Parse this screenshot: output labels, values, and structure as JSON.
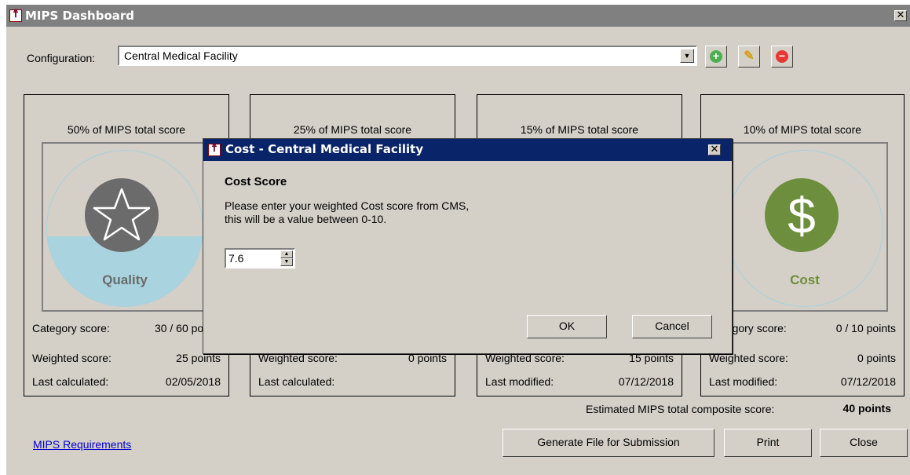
{
  "window": {
    "title": "MIPS Dashboard",
    "close_glyph": "✕"
  },
  "config": {
    "label": "Configuration:",
    "value": "Central Medical Facility"
  },
  "toolbar": {
    "add_icon": "plus-circle-icon",
    "edit_icon": "pencil-icon",
    "remove_icon": "minus-circle-icon"
  },
  "cards": [
    {
      "percent": "50% of MIPS total score",
      "graphic_label": "Quality",
      "fill_level": 0.45,
      "rows": [
        {
          "k": "Category score:",
          "v": "30 / 60 points"
        },
        {
          "k": "Weighted score:",
          "v": "25 points"
        },
        {
          "k": "Last calculated:",
          "v": "02/05/2018"
        }
      ]
    },
    {
      "percent": "25% of MIPS total score",
      "rows": [
        {
          "k": "",
          "v": ""
        },
        {
          "k": "Weighted score:",
          "v": "0 points"
        },
        {
          "k": "Last calculated:",
          "v": ""
        }
      ]
    },
    {
      "percent": "15% of MIPS total score",
      "rows": [
        {
          "k": "",
          "v": ""
        },
        {
          "k": "Weighted score:",
          "v": "15 points"
        },
        {
          "k": "Last modified:",
          "v": "07/12/2018"
        }
      ]
    },
    {
      "percent": "10% of MIPS total score",
      "graphic_label": "Cost",
      "rows": [
        {
          "k": "Category score:",
          "v": "0 / 10 points"
        },
        {
          "k": "Weighted score:",
          "v": "0 points"
        },
        {
          "k": "Last modified:",
          "v": "07/12/2018"
        }
      ]
    }
  ],
  "estimate": {
    "label": "Estimated MIPS total composite score:",
    "value": "40 points"
  },
  "link": "MIPS Requirements",
  "buttons": {
    "generate": "Generate File for Submission",
    "print": "Print",
    "close": "Close"
  },
  "dialog": {
    "title": "Cost - Central Medical Facility",
    "heading": "Cost Score",
    "line1": "Please enter your weighted Cost score from CMS,",
    "line2": "this will be a value between 0-10.",
    "value": "7.6",
    "ok": "OK",
    "cancel": "Cancel"
  },
  "colors": {
    "quality_disk": "#6b6b6b",
    "quality_label": "#6b6b6b",
    "cost_disk": "#6d8e3c",
    "cost_label": "#6d8e3c",
    "dialog_title": "#0a246a",
    "fill": "#a9d3de"
  }
}
